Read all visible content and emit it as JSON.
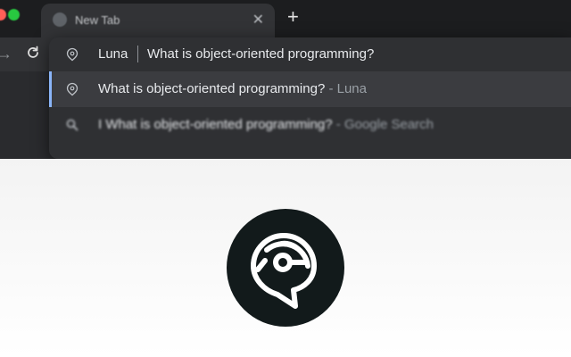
{
  "browser": {
    "tab_title": "New Tab",
    "tab_close_icon": "close-icon",
    "new_tab_icon": "plus-icon",
    "nav": {
      "forward_icon": "arrow-right-icon",
      "reload_icon": "reload-icon"
    }
  },
  "omnibox": {
    "keyword": "Luna",
    "query": "What is object-oriented programming?",
    "icon": "luna-icon"
  },
  "suggestions": [
    {
      "text": "What is object-oriented programming?",
      "subtext": " - Luna",
      "icon": "luna-icon",
      "selected": true
    },
    {
      "text": "I What is object-oriented programming?",
      "subtext": " - Google Search",
      "icon": "search-icon",
      "selected": false
    }
  ],
  "colors": {
    "accent": "#8ab4f8",
    "logo_background": "#121a1b"
  },
  "logo": {
    "icon": "luna-logo-icon"
  }
}
